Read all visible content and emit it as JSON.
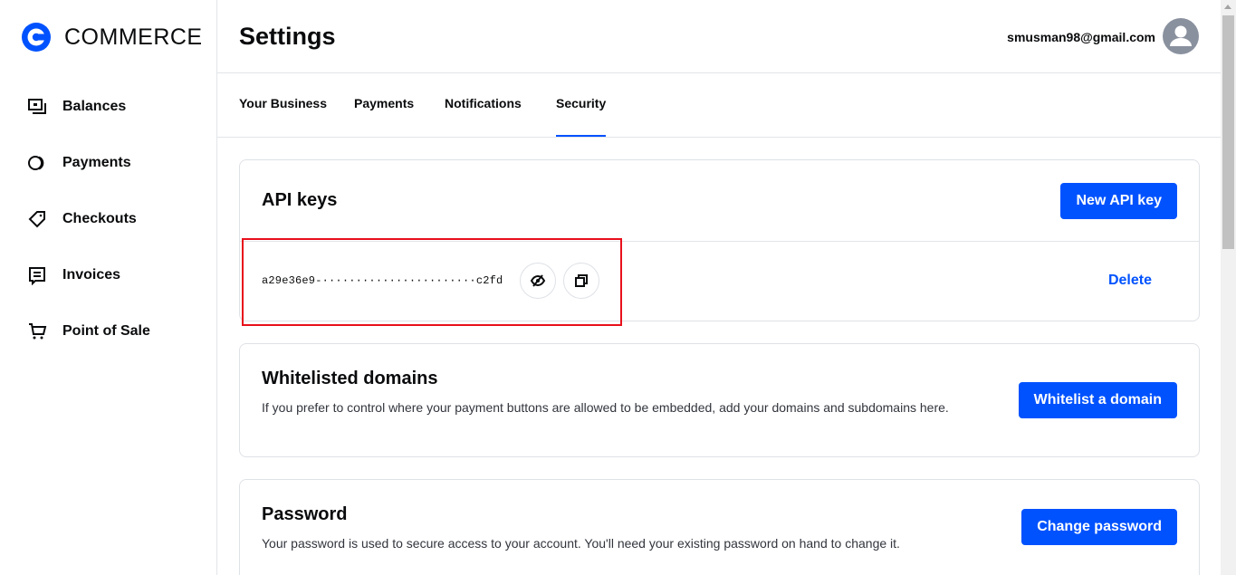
{
  "brand": {
    "name": "COMMERCE"
  },
  "sidebar": {
    "items": [
      {
        "label": "Balances",
        "icon": "balances-icon"
      },
      {
        "label": "Payments",
        "icon": "payments-icon"
      },
      {
        "label": "Checkouts",
        "icon": "tag-icon"
      },
      {
        "label": "Invoices",
        "icon": "invoice-icon"
      },
      {
        "label": "Point of Sale",
        "icon": "cart-icon"
      }
    ]
  },
  "header": {
    "title": "Settings",
    "user_email": "smusman98@gmail.com"
  },
  "tabs": [
    {
      "label": "Your Business",
      "active": false
    },
    {
      "label": "Payments",
      "active": false
    },
    {
      "label": "Notifications",
      "active": false
    },
    {
      "label": "Security",
      "active": true
    }
  ],
  "api_keys": {
    "title": "API keys",
    "new_button": "New API key",
    "key_masked": "a29e36e9-·······················c2fd",
    "delete_label": "Delete"
  },
  "whitelist": {
    "title": "Whitelisted domains",
    "description": "If you prefer to control where your payment buttons are allowed to be embedded, add your domains and subdomains here.",
    "button": "Whitelist a domain"
  },
  "password": {
    "title": "Password",
    "description": "Your password is used to secure access to your account. You'll need your existing password on hand to change it.",
    "button": "Change password"
  },
  "colors": {
    "accent": "#0052ff",
    "highlight": "#e8101b"
  }
}
